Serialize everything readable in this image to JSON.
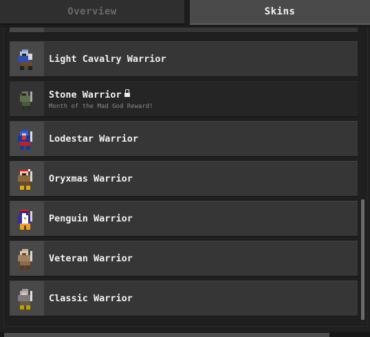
{
  "tabs": {
    "overview": "Overview",
    "skins": "Skins"
  },
  "skins": [
    {
      "name": "Light Cavalry Warrior",
      "icon": "light-cavalry-warrior-sprite",
      "locked": false
    },
    {
      "name": "Stone Warrior",
      "icon": "stone-warrior-sprite",
      "locked": true,
      "subtitle": "Month of the Mad God Reward!"
    },
    {
      "name": "Lodestar Warrior",
      "icon": "lodestar-warrior-sprite",
      "locked": false
    },
    {
      "name": "Oryxmas Warrior",
      "icon": "oryxmas-warrior-sprite",
      "locked": false
    },
    {
      "name": "Penguin Warrior",
      "icon": "penguin-warrior-sprite",
      "locked": false
    },
    {
      "name": "Veteran Warrior",
      "icon": "veteran-warrior-sprite",
      "locked": false
    },
    {
      "name": "Classic Warrior",
      "icon": "classic-warrior-sprite",
      "locked": false
    }
  ],
  "colors": {
    "accent_active_tab": "#4a4a4a",
    "row": "#363636",
    "locked_row": "#252525"
  }
}
